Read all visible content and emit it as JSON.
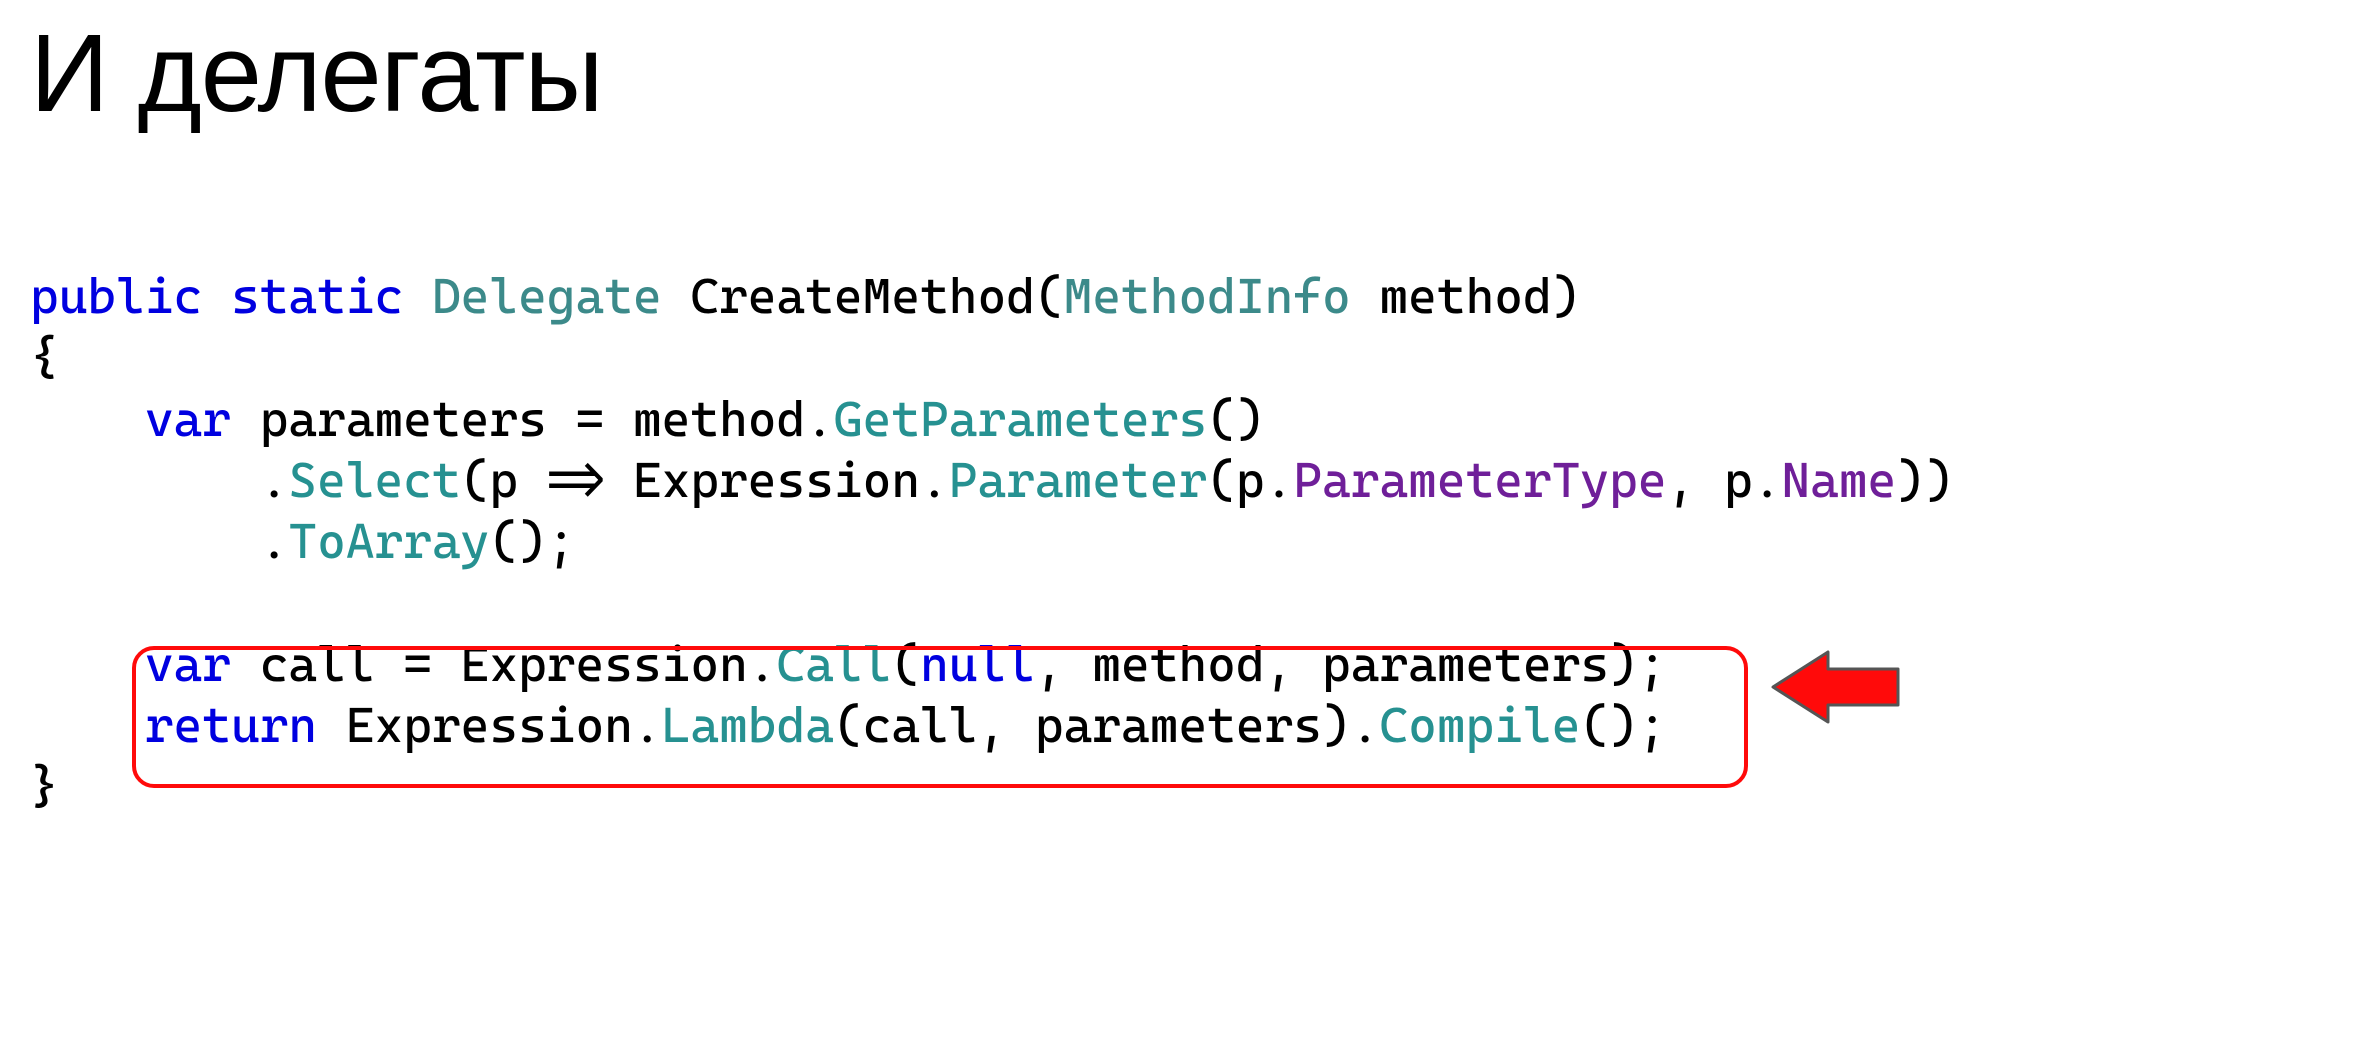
{
  "title": "И делегаты",
  "code": {
    "line1": {
      "kw_public": "public",
      "kw_static": "static",
      "type_delegate": "Delegate",
      "fn": "CreateMethod",
      "type_methodinfo": "MethodInfo",
      "param": "method"
    },
    "line2": {
      "brace": "{"
    },
    "line3": {
      "kw_var": "var",
      "ident": "parameters = method.",
      "m_getparams": "GetParameters",
      "tail": "()"
    },
    "line4": {
      "dot": ".",
      "m_select": "Select",
      "mid1": "(p => Expression.",
      "m_parameter": "Parameter",
      "mid2": "(p.",
      "p_ptype": "ParameterType",
      "mid3": ", p.",
      "p_name": "Name",
      "tail": "))"
    },
    "line5": {
      "dot": ".",
      "m_toarray": "ToArray",
      "tail": "();"
    },
    "line7": {
      "kw_var": "var",
      "mid1": " call = Expression.",
      "m_call": "Call",
      "mid2": "(",
      "kw_null": "null",
      "tail": ", method, parameters);"
    },
    "line8": {
      "kw_return": "return",
      "mid1": " Expression.",
      "m_lambda": "Lambda",
      "mid2": "(call, parameters).",
      "m_compile": "Compile",
      "tail": "();"
    },
    "line9": {
      "brace": "}"
    }
  },
  "highlight": {
    "top_px": "379",
    "left_px": "102",
    "width_px": "1608",
    "height_px": "134"
  },
  "arrow": {
    "top_px": "370",
    "left_px": "1738"
  }
}
